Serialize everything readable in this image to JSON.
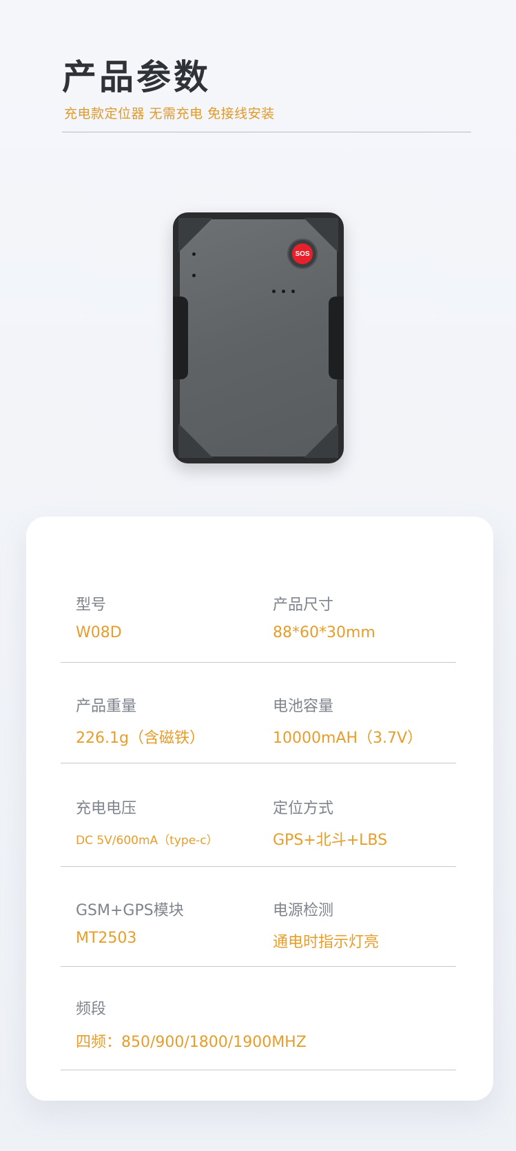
{
  "header": {
    "title": "产品参数",
    "subtitle": "充电款定位器 无需充电 免接线安装"
  },
  "device": {
    "sos_label": "SOS"
  },
  "specs": {
    "model_label": "型号",
    "model_value": "W08D",
    "size_label": "产品尺寸",
    "size_value": "88*60*30mm",
    "weight_label": "产品重量",
    "weight_value": "226.1g（含磁铁）",
    "battery_label": "电池容量",
    "battery_value": "10000mAH（3.7V）",
    "charge_label": "充电电压",
    "charge_value": "DC 5V/600mA（type-c）",
    "positioning_label": "定位方式",
    "positioning_value": "GPS+北斗+LBS",
    "module_label": "GSM+GPS模块",
    "module_value": "MT2503",
    "power_label": "电源检测",
    "power_value": "通电时指示灯亮",
    "band_label": "频段",
    "band_value": "四频：850/900/1800/1900MHZ"
  },
  "colors": {
    "accent": "#e79d2a",
    "label": "#7d848c",
    "title": "#2f3337",
    "sos": "#e8202c"
  }
}
